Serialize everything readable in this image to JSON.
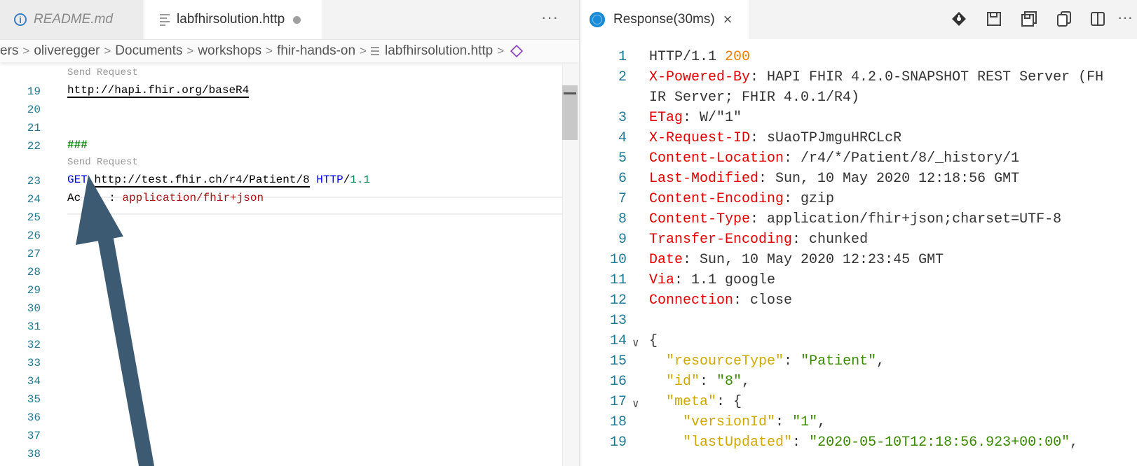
{
  "left_pane": {
    "tabs": [
      {
        "label": "README.md",
        "icon": "info-icon"
      },
      {
        "label": "labfhirsolution.http",
        "icon": "file-lines-icon",
        "dirty": true
      }
    ],
    "more_label": "···",
    "breadcrumb": [
      "ers",
      "oliveregger",
      "Documents",
      "workshops",
      "fhir-hands-on",
      "labfhirsolution.http"
    ],
    "breadcrumb_sep": ">",
    "codelens_label": "Send Request",
    "lines": {
      "n19": "19",
      "n20": "20",
      "n21": "21",
      "n22": "22",
      "n23": "23",
      "n24": "24",
      "n25": "25",
      "n26": "26",
      "n27": "27",
      "n28": "28",
      "n29": "29",
      "n30": "30",
      "n31": "31",
      "n32": "32",
      "n33": "33",
      "n34": "34",
      "n35": "35",
      "n36": "36",
      "n37": "37",
      "n38": "38"
    },
    "code": {
      "base_url": "http://hapi.fhir.org/baseR4",
      "separator": "###",
      "method": "GET",
      "request_url": "http://test.fhir.ch/r4/Patient/8",
      "http_word": "HTTP",
      "http_slash": "/",
      "http_version": "1.1",
      "accept_visible_start": "Ac",
      "accept_visible_end": ":",
      "accept_value": "application/fhir+json"
    }
  },
  "right_pane": {
    "tab_label": "Response(30ms)",
    "close_glyph": "×",
    "toolbar_icons": [
      "git-commit-icon",
      "save-icon",
      "save-all-icon",
      "copy-icon",
      "split-editor-icon"
    ],
    "more_label": "···",
    "lines": [
      {
        "n": "1",
        "parts": [
          {
            "t": "HTTP/1.1 ",
            "c": ""
          },
          {
            "t": "200",
            "c": "status"
          }
        ]
      },
      {
        "n": "2",
        "parts": [
          {
            "t": "X-Powered-By",
            "c": "hname"
          },
          {
            "t": ": HAPI FHIR 4.2.0-SNAPSHOT REST Server (FH",
            "c": ""
          }
        ]
      },
      {
        "n": "",
        "parts": [
          {
            "t": "IR Server; FHIR 4.0.1/R4)",
            "c": ""
          }
        ]
      },
      {
        "n": "3",
        "parts": [
          {
            "t": "ETag",
            "c": "hname"
          },
          {
            "t": ": W/\"1\"",
            "c": ""
          }
        ]
      },
      {
        "n": "4",
        "parts": [
          {
            "t": "X-Request-ID",
            "c": "hname"
          },
          {
            "t": ": sUaoTPJmguHRCLcR",
            "c": ""
          }
        ]
      },
      {
        "n": "5",
        "parts": [
          {
            "t": "Content-Location",
            "c": "hname"
          },
          {
            "t": ": /r4/*/Patient/8/_history/1",
            "c": ""
          }
        ]
      },
      {
        "n": "6",
        "parts": [
          {
            "t": "Last-Modified",
            "c": "hname"
          },
          {
            "t": ": Sun, 10 May 2020 12:18:56 GMT",
            "c": ""
          }
        ]
      },
      {
        "n": "7",
        "parts": [
          {
            "t": "Content-Encoding",
            "c": "hname"
          },
          {
            "t": ": gzip",
            "c": ""
          }
        ]
      },
      {
        "n": "8",
        "parts": [
          {
            "t": "Content-Type",
            "c": "hname"
          },
          {
            "t": ": application/fhir+json;charset=UTF-8",
            "c": ""
          }
        ]
      },
      {
        "n": "9",
        "parts": [
          {
            "t": "Transfer-Encoding",
            "c": "hname"
          },
          {
            "t": ": chunked",
            "c": ""
          }
        ]
      },
      {
        "n": "10",
        "parts": [
          {
            "t": "Date",
            "c": "hname"
          },
          {
            "t": ": Sun, 10 May 2020 12:23:45 GMT",
            "c": ""
          }
        ]
      },
      {
        "n": "11",
        "parts": [
          {
            "t": "Via",
            "c": "hname"
          },
          {
            "t": ": 1.1 google",
            "c": ""
          }
        ]
      },
      {
        "n": "12",
        "parts": [
          {
            "t": "Connection",
            "c": "hname"
          },
          {
            "t": ": close",
            "c": ""
          }
        ]
      },
      {
        "n": "13",
        "parts": []
      },
      {
        "n": "14",
        "fold": true,
        "parts": [
          {
            "t": "{",
            "c": ""
          }
        ]
      },
      {
        "n": "15",
        "parts": [
          {
            "t": "  ",
            "c": ""
          },
          {
            "t": "\"resourceType\"",
            "c": "jkey"
          },
          {
            "t": ": ",
            "c": ""
          },
          {
            "t": "\"Patient\"",
            "c": "jstr"
          },
          {
            "t": ",",
            "c": ""
          }
        ]
      },
      {
        "n": "16",
        "parts": [
          {
            "t": "  ",
            "c": ""
          },
          {
            "t": "\"id\"",
            "c": "jkey"
          },
          {
            "t": ": ",
            "c": ""
          },
          {
            "t": "\"8\"",
            "c": "jstr"
          },
          {
            "t": ",",
            "c": ""
          }
        ]
      },
      {
        "n": "17",
        "fold": true,
        "parts": [
          {
            "t": "  ",
            "c": ""
          },
          {
            "t": "\"meta\"",
            "c": "jkey"
          },
          {
            "t": ": {",
            "c": ""
          }
        ]
      },
      {
        "n": "18",
        "parts": [
          {
            "t": "    ",
            "c": ""
          },
          {
            "t": "\"versionId\"",
            "c": "jkey"
          },
          {
            "t": ": ",
            "c": ""
          },
          {
            "t": "\"1\"",
            "c": "jstr"
          },
          {
            "t": ",",
            "c": ""
          }
        ]
      },
      {
        "n": "19",
        "parts": [
          {
            "t": "    ",
            "c": ""
          },
          {
            "t": "\"lastUpdated\"",
            "c": "jkey"
          },
          {
            "t": ": ",
            "c": ""
          },
          {
            "t": "\"2020-05-10T12:18:56.923+00:00\"",
            "c": "jstr"
          },
          {
            "t": ",",
            "c": ""
          }
        ]
      }
    ]
  },
  "colors": {
    "header_name": "#e00000",
    "status_code": "#f08000",
    "json_key": "#cfa800",
    "json_string": "#3a8a00",
    "line_number": "#237893",
    "annotation_arrow": "#3d5a73"
  }
}
